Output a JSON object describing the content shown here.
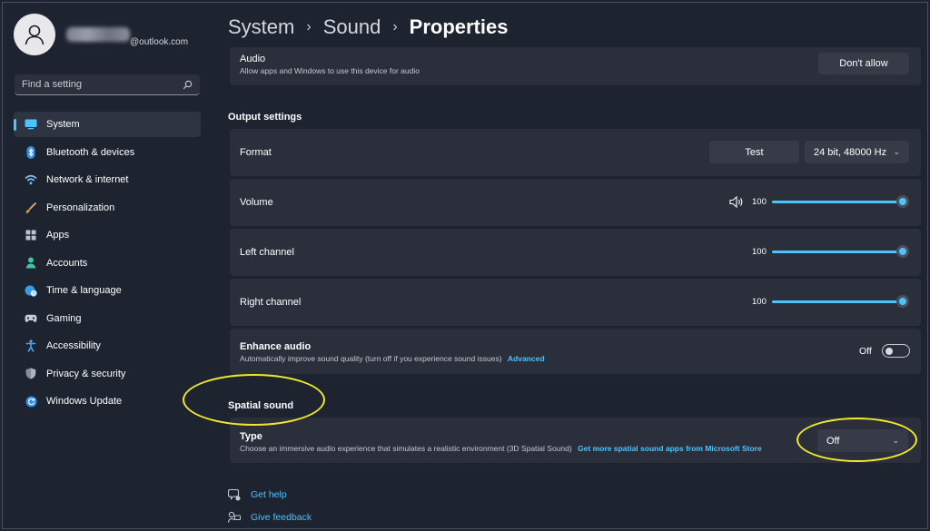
{
  "account": {
    "email_suffix": "@outlook.com"
  },
  "search": {
    "placeholder": "Find a setting"
  },
  "sidebar": {
    "items": [
      {
        "label": "System",
        "icon": "monitor-icon",
        "active": true
      },
      {
        "label": "Bluetooth & devices",
        "icon": "bluetooth-icon"
      },
      {
        "label": "Network & internet",
        "icon": "wifi-icon"
      },
      {
        "label": "Personalization",
        "icon": "brush-icon"
      },
      {
        "label": "Apps",
        "icon": "apps-icon"
      },
      {
        "label": "Accounts",
        "icon": "person-icon"
      },
      {
        "label": "Time & language",
        "icon": "globe-clock-icon"
      },
      {
        "label": "Gaming",
        "icon": "gamepad-icon"
      },
      {
        "label": "Accessibility",
        "icon": "accessibility-icon"
      },
      {
        "label": "Privacy & security",
        "icon": "shield-icon"
      },
      {
        "label": "Windows Update",
        "icon": "update-icon"
      }
    ]
  },
  "breadcrumb": {
    "root": "System",
    "middle": "Sound",
    "current": "Properties"
  },
  "audio": {
    "title": "Audio",
    "subtitle": "Allow apps and Windows to use this device for audio",
    "button": "Don't allow"
  },
  "output": {
    "section": "Output settings",
    "format": {
      "label": "Format",
      "test_button": "Test",
      "value": "24 bit, 48000 Hz"
    },
    "volume": {
      "label": "Volume",
      "value": "100"
    },
    "left": {
      "label": "Left channel",
      "value": "100"
    },
    "right": {
      "label": "Right channel",
      "value": "100"
    },
    "enhance": {
      "title": "Enhance audio",
      "subtitle": "Automatically improve sound quality (turn off if you experience sound issues)",
      "link": "Advanced",
      "state": "Off"
    }
  },
  "spatial": {
    "section": "Spatial sound",
    "type": {
      "title": "Type",
      "subtitle": "Choose an immersive audio experience that simulates a realistic environment (3D Spatial Sound)",
      "link": "Get more spatial sound apps from Microsoft Store",
      "value": "Off"
    }
  },
  "footer": {
    "help": "Get help",
    "feedback": "Give feedback"
  },
  "colors": {
    "accent": "#4cc2ff",
    "highlight": "#f1ea2a",
    "background": "#1e2330",
    "card": "#2a2f3b"
  }
}
